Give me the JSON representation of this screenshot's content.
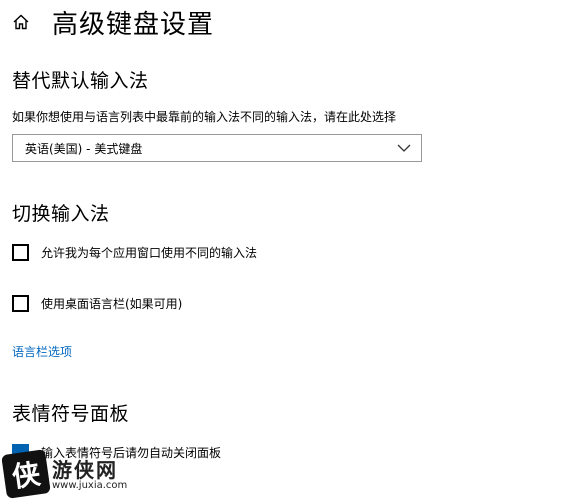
{
  "page": {
    "title": "高级键盘设置"
  },
  "override": {
    "heading": "替代默认输入法",
    "description": "如果你想使用与语言列表中最靠前的输入法不同的输入法，请在此处选择",
    "selected": "英语(美国) - 美式键盘"
  },
  "switching": {
    "heading": "切换输入法",
    "option1": "允许我为每个应用窗口使用不同的输入法",
    "option1_checked": false,
    "option2": "使用桌面语言栏(如果可用)",
    "option2_checked": false,
    "link": "语言栏选项"
  },
  "emoji": {
    "heading": "表情符号面板",
    "option1": "输入表情符号后请勿自动关闭面板",
    "option1_checked": true
  },
  "watermark": {
    "logo_char": "侠",
    "name": "游侠网",
    "url": "www.juxia.com"
  },
  "colors": {
    "accent": "#0063b1",
    "link": "#0067c0"
  }
}
